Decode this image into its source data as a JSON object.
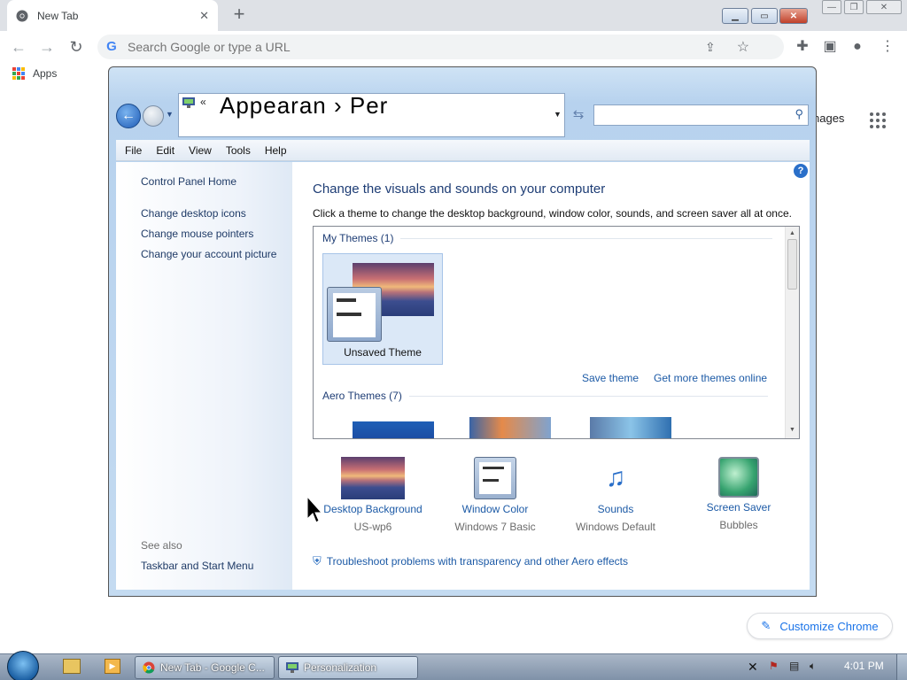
{
  "browser": {
    "tab_title": "New Tab",
    "tab_close": "✕",
    "new_tab": "+",
    "omnibox_placeholder": "Search Google or type a URL",
    "bookmarks_apps": "Apps",
    "customize_label": "Customize Chrome",
    "images_peek": "nages"
  },
  "window": {
    "address_text": "Appearan  ›  Per",
    "address_prefix": "«",
    "menu": [
      "File",
      "Edit",
      "View",
      "Tools",
      "Help"
    ],
    "help": "?",
    "left_pane": {
      "home": "Control Panel Home",
      "links": [
        "Change desktop icons",
        "Change mouse pointers",
        "Change your account picture"
      ],
      "see_also": "See also",
      "see_also_link": "Taskbar and Start Menu"
    },
    "main": {
      "title": "Change the visuals and sounds on your computer",
      "description": "Click a theme to change the desktop background, window color, sounds, and screen saver all at once.",
      "my_themes": "My Themes (1)",
      "unsaved_theme": "Unsaved Theme",
      "save_theme": "Save theme",
      "get_more": "Get more themes online",
      "aero_themes": "Aero Themes (7)"
    },
    "bottom_items": [
      {
        "label": "Desktop Background",
        "sub": "US-wp6"
      },
      {
        "label": "Window Color",
        "sub": "Windows 7 Basic"
      },
      {
        "label": "Sounds",
        "sub": "Windows Default"
      },
      {
        "label": "Screen Saver",
        "sub": "Bubbles"
      }
    ],
    "troubleshoot": "Troubleshoot problems with transparency and other Aero effects"
  },
  "taskbar": {
    "items": [
      "New Tab - Google C...",
      "Personalization"
    ],
    "clock": "4:01 PM"
  },
  "colors": {
    "accent": "#1a73e8",
    "link": "#1c5aa6"
  }
}
